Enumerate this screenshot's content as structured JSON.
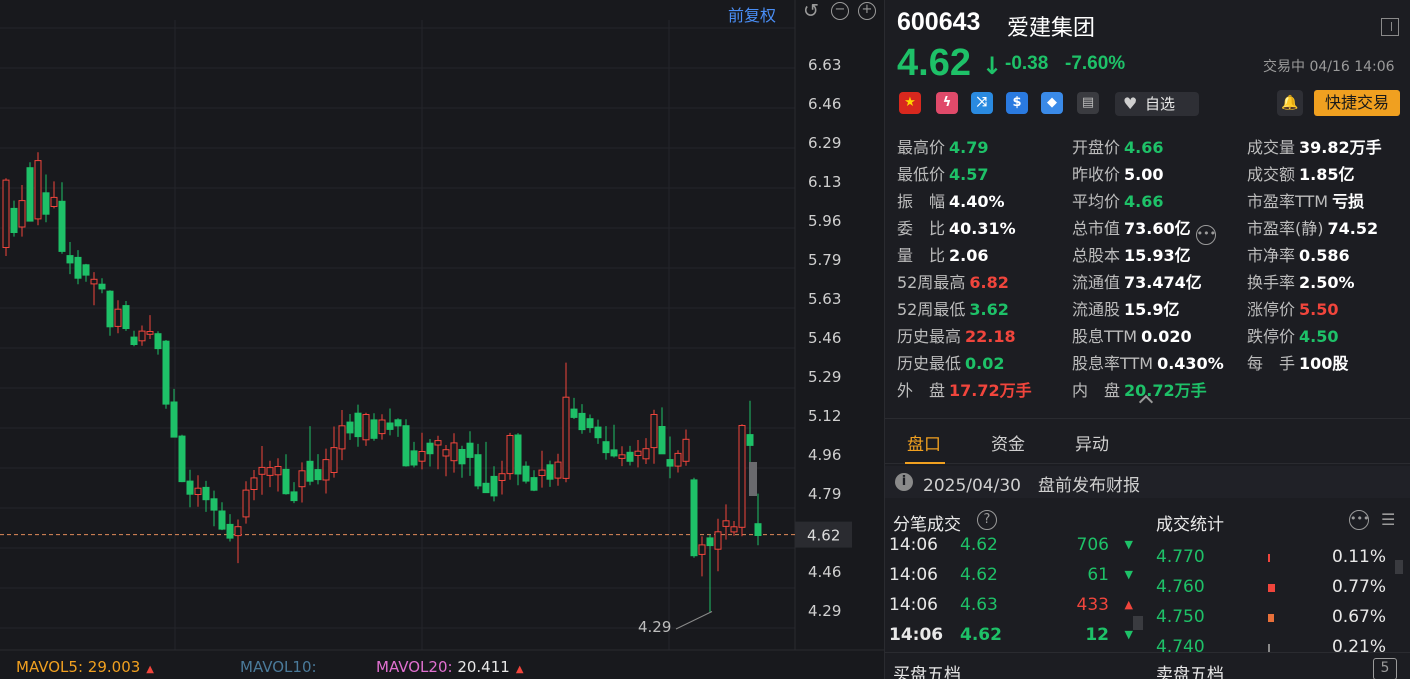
{
  "toolbar": {
    "adjust_label": "前复权"
  },
  "chart": {
    "y_ticks": [
      "6.63",
      "6.46",
      "6.29",
      "6.13",
      "5.96",
      "5.79",
      "5.63",
      "5.46",
      "5.29",
      "5.12",
      "4.96",
      "4.79",
      "4.62",
      "4.46",
      "4.29"
    ],
    "current_price_label": "4.62",
    "low_marker_label": "4.29",
    "mavol5": {
      "label": "MAVOL5:",
      "value": "29.003"
    },
    "mavol10": {
      "label": "MAVOL10:",
      "value": ""
    },
    "mavol20": {
      "label": "MAVOL20:",
      "value": "20.411"
    },
    "colors": {
      "up": "#f0453c",
      "down": "#1ec168",
      "mavol5": "#f0a020",
      "mavol10": "#4a7a9a",
      "mavol20": "#e070d0"
    }
  },
  "chart_data": {
    "type": "candlestick",
    "title": "",
    "xlabel": "",
    "ylabel": "",
    "ylim": [
      4.21,
      6.76
    ],
    "current_price": 4.62,
    "annotations": [
      {
        "text": "4.29",
        "value": 4.29
      }
    ],
    "candles": [
      {
        "o": 5.85,
        "h": 6.0,
        "l": 5.83,
        "c": 5.97
      },
      {
        "o": 5.97,
        "h": 6.05,
        "l": 5.9,
        "c": 5.93
      },
      {
        "o": 5.93,
        "h": 6.1,
        "l": 5.9,
        "c": 6.05
      },
      {
        "o": 6.05,
        "h": 6.12,
        "l": 6.0,
        "c": 6.03
      },
      {
        "o": 5.98,
        "h": 6.28,
        "l": 5.95,
        "c": 6.25
      },
      {
        "o": 6.12,
        "h": 6.18,
        "l": 5.97,
        "c": 6.03
      },
      {
        "o": 6.0,
        "h": 6.15,
        "l": 5.98,
        "c": 6.1
      },
      {
        "o": 6.08,
        "h": 6.1,
        "l": 5.8,
        "c": 5.82
      },
      {
        "o": 5.8,
        "h": 5.85,
        "l": 5.75,
        "c": 5.78
      },
      {
        "o": 5.8,
        "h": 5.82,
        "l": 5.68,
        "c": 5.7
      },
      {
        "o": 5.7,
        "h": 5.78,
        "l": 5.65,
        "c": 5.75
      },
      {
        "o": 5.72,
        "h": 5.76,
        "l": 5.65,
        "c": 5.67
      },
      {
        "o": 5.67,
        "h": 5.7,
        "l": 5.5,
        "c": 5.52
      },
      {
        "o": 5.52,
        "h": 5.6,
        "l": 5.48,
        "c": 5.58
      },
      {
        "o": 5.58,
        "h": 5.6,
        "l": 5.42,
        "c": 5.44
      },
      {
        "o": 5.44,
        "h": 5.52,
        "l": 5.4,
        "c": 5.48
      },
      {
        "o": 5.48,
        "h": 5.55,
        "l": 5.45,
        "c": 5.5
      },
      {
        "o": 5.5,
        "h": 5.52,
        "l": 5.44,
        "c": 5.46
      },
      {
        "o": 5.46,
        "h": 5.47,
        "l": 5.16,
        "c": 5.18
      },
      {
        "o": 5.18,
        "h": 5.2,
        "l": 4.99,
        "c": 5.02
      },
      {
        "o": 5.02,
        "h": 5.03,
        "l": 4.78,
        "c": 4.8
      },
      {
        "o": 4.8,
        "h": 4.82,
        "l": 4.72,
        "c": 4.75
      },
      {
        "o": 4.75,
        "h": 4.85,
        "l": 4.7,
        "c": 4.8
      },
      {
        "o": 4.8,
        "h": 4.82,
        "l": 4.72,
        "c": 4.74
      },
      {
        "o": 4.74,
        "h": 4.78,
        "l": 4.65,
        "c": 4.68
      },
      {
        "o": 4.68,
        "h": 4.72,
        "l": 4.62,
        "c": 4.66
      },
      {
        "o": 4.66,
        "h": 4.68,
        "l": 4.52,
        "c": 4.62
      },
      {
        "o": 4.68,
        "h": 4.76,
        "l": 4.62,
        "c": 4.7
      },
      {
        "o": 4.7,
        "h": 4.82,
        "l": 4.68,
        "c": 4.8
      },
      {
        "o": 4.8,
        "h": 4.86,
        "l": 4.75,
        "c": 4.84
      },
      {
        "o": 4.84,
        "h": 4.96,
        "l": 4.8,
        "c": 4.88
      },
      {
        "o": 4.88,
        "h": 4.92,
        "l": 4.82,
        "c": 4.86
      },
      {
        "o": 4.86,
        "h": 4.9,
        "l": 4.82,
        "c": 4.88
      },
      {
        "o": 4.88,
        "h": 4.92,
        "l": 4.78,
        "c": 4.8
      },
      {
        "o": 4.8,
        "h": 4.84,
        "l": 4.75,
        "c": 4.77
      },
      {
        "o": 4.77,
        "h": 4.85,
        "l": 4.72,
        "c": 4.82
      },
      {
        "o": 4.82,
        "h": 5.02,
        "l": 4.8,
        "c": 4.9
      },
      {
        "o": 4.9,
        "h": 4.96,
        "l": 4.84,
        "c": 4.87
      },
      {
        "o": 4.87,
        "h": 5.0,
        "l": 4.8,
        "c": 4.95
      },
      {
        "o": 4.95,
        "h": 5.06,
        "l": 4.9,
        "c": 5.02
      },
      {
        "o": 5.02,
        "h": 5.15,
        "l": 5.0,
        "c": 5.1
      },
      {
        "o": 5.1,
        "h": 5.14,
        "l": 5.02,
        "c": 5.05
      },
      {
        "o": 5.05,
        "h": 5.12,
        "l": 4.98,
        "c": 5.0
      },
      {
        "o": 5.0,
        "h": 5.1,
        "l": 4.95,
        "c": 5.08
      },
      {
        "o": 5.08,
        "h": 5.12,
        "l": 5.02,
        "c": 5.04
      },
      {
        "o": 5.04,
        "h": 5.08,
        "l": 4.98,
        "c": 5.06
      },
      {
        "o": 5.06,
        "h": 5.1,
        "l": 5.02,
        "c": 5.04
      },
      {
        "o": 5.04,
        "h": 5.06,
        "l": 4.88,
        "c": 4.9
      },
      {
        "o": 4.9,
        "h": 4.94,
        "l": 4.85,
        "c": 4.88
      },
      {
        "o": 4.88,
        "h": 4.98,
        "l": 4.86,
        "c": 4.96
      },
      {
        "o": 4.96,
        "h": 5.0,
        "l": 4.9,
        "c": 4.93
      },
      {
        "o": 4.93,
        "h": 4.97,
        "l": 4.88,
        "c": 4.91
      },
      {
        "o": 4.91,
        "h": 4.96,
        "l": 4.86,
        "c": 4.95
      },
      {
        "o": 4.95,
        "h": 4.98,
        "l": 4.88,
        "c": 4.9
      },
      {
        "o": 4.9,
        "h": 5.0,
        "l": 4.82,
        "c": 4.84
      },
      {
        "o": 4.84,
        "h": 4.9,
        "l": 4.78,
        "c": 4.8
      },
      {
        "o": 4.8,
        "h": 4.85,
        "l": 4.76,
        "c": 4.82
      },
      {
        "o": 4.82,
        "h": 4.9,
        "l": 4.8,
        "c": 4.88
      },
      {
        "o": 4.88,
        "h": 5.02,
        "l": 4.86,
        "c": 5.0
      },
      {
        "o": 5.0,
        "h": 5.02,
        "l": 4.85,
        "c": 4.87
      },
      {
        "o": 4.87,
        "h": 4.92,
        "l": 4.8,
        "c": 4.85
      },
      {
        "o": 4.85,
        "h": 4.88,
        "l": 4.78,
        "c": 4.82
      },
      {
        "o": 4.82,
        "h": 4.9,
        "l": 4.8,
        "c": 4.88
      },
      {
        "o": 4.88,
        "h": 4.94,
        "l": 4.84,
        "c": 4.86
      },
      {
        "o": 4.84,
        "h": 5.3,
        "l": 4.82,
        "c": 5.16
      },
      {
        "o": 5.16,
        "h": 5.18,
        "l": 5.08,
        "c": 5.1
      },
      {
        "o": 5.1,
        "h": 5.12,
        "l": 5.05,
        "c": 5.07
      },
      {
        "o": 5.07,
        "h": 5.1,
        "l": 5.0,
        "c": 5.04
      },
      {
        "o": 5.04,
        "h": 5.06,
        "l": 4.97,
        "c": 4.99
      },
      {
        "o": 4.99,
        "h": 5.02,
        "l": 4.94,
        "c": 4.96
      },
      {
        "o": 4.96,
        "h": 5.0,
        "l": 4.9,
        "c": 4.92
      },
      {
        "o": 4.92,
        "h": 4.96,
        "l": 4.88,
        "c": 4.94
      },
      {
        "o": 4.94,
        "h": 4.96,
        "l": 4.88,
        "c": 4.9
      },
      {
        "o": 4.9,
        "h": 4.95,
        "l": 4.86,
        "c": 4.93
      },
      {
        "o": 4.93,
        "h": 4.97,
        "l": 4.9,
        "c": 4.94
      },
      {
        "o": 4.94,
        "h": 5.12,
        "l": 4.9,
        "c": 5.05
      },
      {
        "o": 5.05,
        "h": 5.1,
        "l": 4.96,
        "c": 4.98
      },
      {
        "o": 4.98,
        "h": 5.02,
        "l": 4.86,
        "c": 4.88
      },
      {
        "o": 4.88,
        "h": 4.96,
        "l": 4.84,
        "c": 4.94
      },
      {
        "o": 4.94,
        "h": 5.02,
        "l": 4.9,
        "c": 5.0
      },
      {
        "o": 4.82,
        "h": 4.84,
        "l": 4.58,
        "c": 4.6
      },
      {
        "o": 4.6,
        "h": 4.68,
        "l": 4.54,
        "c": 4.64
      },
      {
        "o": 4.64,
        "h": 4.66,
        "l": 4.29,
        "c": 4.6
      },
      {
        "o": 4.6,
        "h": 4.66,
        "l": 4.56,
        "c": 4.65
      },
      {
        "o": 4.64,
        "h": 4.72,
        "l": 4.6,
        "c": 4.68
      },
      {
        "o": 4.65,
        "h": 4.7,
        "l": 4.62,
        "c": 4.67
      },
      {
        "o": 4.68,
        "h": 5.06,
        "l": 4.66,
        "c": 5.04
      },
      {
        "o": 5.0,
        "h": 5.15,
        "l": 4.95,
        "c": 4.96
      },
      {
        "o": 4.92,
        "h": 4.94,
        "l": 4.76,
        "c": 4.78
      },
      {
        "o": 4.66,
        "h": 4.79,
        "l": 4.57,
        "c": 4.62
      }
    ]
  },
  "header": {
    "code": "600643",
    "name": "爱建集团",
    "price": "4.62",
    "change": "-0.38",
    "change_pct": "-7.60%",
    "status": "交易中 04/16 14:06"
  },
  "actions": {
    "watch_label": "自选",
    "quick_trade_label": "快捷交易"
  },
  "stats": {
    "high": {
      "label": "最高价",
      "value": "4.79"
    },
    "open": {
      "label": "开盘价",
      "value": "4.66"
    },
    "volume": {
      "label": "成交量",
      "value": "39.82万手"
    },
    "low": {
      "label": "最低价",
      "value": "4.57"
    },
    "prev_close": {
      "label": "昨收价",
      "value": "5.00"
    },
    "turnover": {
      "label": "成交额",
      "value": "1.85亿"
    },
    "amplitude": {
      "label": "振　幅",
      "value": "4.40%"
    },
    "avg": {
      "label": "平均价",
      "value": "4.66"
    },
    "pe_ttm": {
      "label": "市盈率TTM",
      "value": "亏损"
    },
    "bid_ratio": {
      "label": "委　比",
      "value": "40.31%"
    },
    "mkt_cap": {
      "label": "总市值",
      "value": "73.60亿"
    },
    "pe_static": {
      "label": "市盈率(静)",
      "value": "74.52"
    },
    "vol_ratio": {
      "label": "量　比",
      "value": "2.06"
    },
    "total_shares": {
      "label": "总股本",
      "value": "15.93亿"
    },
    "pb": {
      "label": "市净率",
      "value": "0.586"
    },
    "w52_high": {
      "label": "52周最高",
      "value": "6.82"
    },
    "float_cap": {
      "label": "流通值",
      "value": "73.474亿"
    },
    "turnover_rate": {
      "label": "换手率",
      "value": "2.50%"
    },
    "w52_low": {
      "label": "52周最低",
      "value": "3.62"
    },
    "float_shares": {
      "label": "流通股",
      "value": "15.9亿"
    },
    "limit_up": {
      "label": "涨停价",
      "value": "5.50"
    },
    "hist_high": {
      "label": "历史最高",
      "value": "22.18"
    },
    "div_ttm": {
      "label": "股息TTM",
      "value": "0.020"
    },
    "limit_down": {
      "label": "跌停价",
      "value": "4.50"
    },
    "hist_low": {
      "label": "历史最低",
      "value": "0.02"
    },
    "div_yield": {
      "label": "股息率TTM",
      "value": "0.430%"
    },
    "lot": {
      "label": "每　手",
      "value": "100股"
    },
    "outer": {
      "label": "外　盘",
      "value": "17.72万手"
    },
    "inner": {
      "label": "内　盘",
      "value": "20.72万手"
    }
  },
  "tabs": [
    {
      "label": "盘口"
    },
    {
      "label": "资金"
    },
    {
      "label": "异动"
    }
  ],
  "notice": {
    "text": "2025/04/30　盘前发布财报"
  },
  "ticks_section": {
    "title": "分笔成交"
  },
  "ticks": [
    {
      "time": "14:06",
      "price": "4.62",
      "vol": "706",
      "dir": "down"
    },
    {
      "time": "14:06",
      "price": "4.62",
      "vol": "61",
      "dir": "down"
    },
    {
      "time": "14:06",
      "price": "4.63",
      "vol": "433",
      "dir": "up"
    },
    {
      "time": "14:06",
      "price": "4.62",
      "vol": "12",
      "dir": "down"
    }
  ],
  "vol_stats_section": {
    "title": "成交统计"
  },
  "vol_stats": [
    {
      "price": "4.770",
      "pct": "0.11%",
      "share": 0.11
    },
    {
      "price": "4.760",
      "pct": "0.77%",
      "share": 0.77
    },
    {
      "price": "4.750",
      "pct": "0.67%",
      "share": 0.67
    },
    {
      "price": "4.740",
      "pct": "0.21%",
      "share": 0.21
    }
  ],
  "bottom": {
    "buy_label": "买盘五档",
    "sell_label": "卖盘五档",
    "five_label": "5"
  }
}
